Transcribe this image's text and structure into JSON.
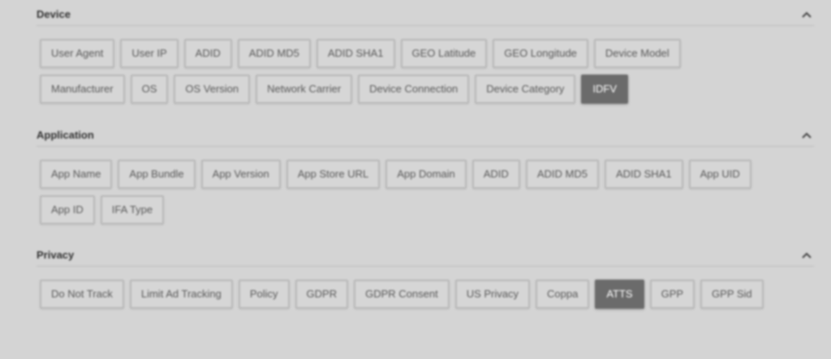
{
  "sections": [
    {
      "title": "Device",
      "tags": [
        {
          "label": "User Agent",
          "active": false
        },
        {
          "label": "User IP",
          "active": false
        },
        {
          "label": "ADID",
          "active": false
        },
        {
          "label": "ADID MD5",
          "active": false
        },
        {
          "label": "ADID SHA1",
          "active": false
        },
        {
          "label": "GEO Latitude",
          "active": false
        },
        {
          "label": "GEO Longitude",
          "active": false
        },
        {
          "label": "Device Model",
          "active": false
        },
        {
          "label": "Manufacturer",
          "active": false
        },
        {
          "label": "OS",
          "active": false
        },
        {
          "label": "OS Version",
          "active": false
        },
        {
          "label": "Network Carrier",
          "active": false
        },
        {
          "label": "Device Connection",
          "active": false
        },
        {
          "label": "Device Category",
          "active": false
        },
        {
          "label": "IDFV",
          "active": true
        }
      ]
    },
    {
      "title": "Application",
      "tags": [
        {
          "label": "App Name",
          "active": false
        },
        {
          "label": "App Bundle",
          "active": false
        },
        {
          "label": "App Version",
          "active": false
        },
        {
          "label": "App Store URL",
          "active": false
        },
        {
          "label": "App Domain",
          "active": false
        },
        {
          "label": "ADID",
          "active": false
        },
        {
          "label": "ADID MD5",
          "active": false
        },
        {
          "label": "ADID SHA1",
          "active": false
        },
        {
          "label": "App UID",
          "active": false
        },
        {
          "label": "App ID",
          "active": false
        },
        {
          "label": "IFA Type",
          "active": false
        }
      ]
    },
    {
      "title": "Privacy",
      "tags": [
        {
          "label": "Do Not Track",
          "active": false
        },
        {
          "label": "Limit Ad Tracking",
          "active": false
        },
        {
          "label": "Policy",
          "active": false
        },
        {
          "label": "GDPR",
          "active": false
        },
        {
          "label": "GDPR Consent",
          "active": false
        },
        {
          "label": "US Privacy",
          "active": false
        },
        {
          "label": "Coppa",
          "active": false
        },
        {
          "label": "ATTS",
          "active": true
        },
        {
          "label": "GPP",
          "active": false
        },
        {
          "label": "GPP Sid",
          "active": false
        }
      ]
    }
  ],
  "icons": {
    "collapse": "chevron-up-icon"
  },
  "colors": {
    "background": "#d4d4d4",
    "tag_border": "#b8b8b8",
    "tag_text": "#5a5a5a",
    "active_tag_bg": "#6b6b6b",
    "active_tag_text": "#ffffff"
  }
}
